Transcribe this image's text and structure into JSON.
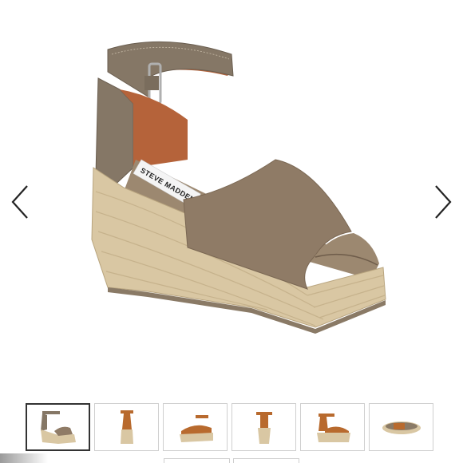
{
  "gallery": {
    "prev_icon": "chevron-left-icon",
    "next_icon": "chevron-right-icon",
    "brand_label": "STEVE MADDEN",
    "colors": {
      "suede": "#8f7b66",
      "leather": "#857766",
      "jute": "#d9c7a3",
      "lining": "#b5633a",
      "tan": "#b86a2e"
    },
    "thumbnails": [
      {
        "variant": "taupe",
        "view": "side",
        "selected": true
      },
      {
        "variant": "cognac",
        "view": "front",
        "selected": false
      },
      {
        "variant": "cognac",
        "view": "side-low",
        "selected": false
      },
      {
        "variant": "cognac",
        "view": "back",
        "selected": false
      },
      {
        "variant": "cognac",
        "view": "angle",
        "selected": false
      },
      {
        "variant": "cognac",
        "view": "sole",
        "selected": false
      }
    ]
  }
}
